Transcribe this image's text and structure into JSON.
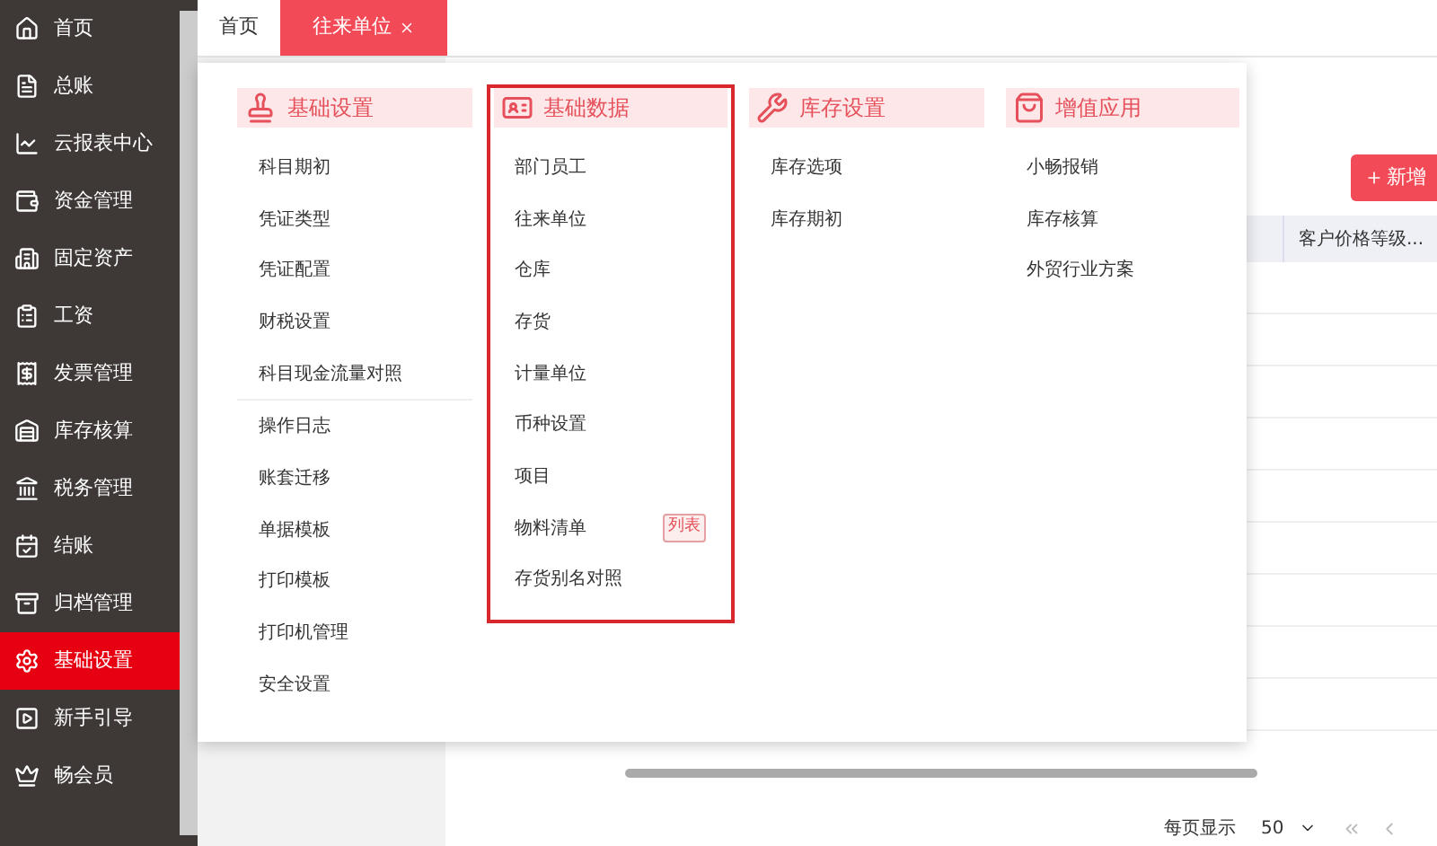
{
  "sidebar": {
    "items": [
      {
        "label": "首页",
        "selected": false
      },
      {
        "label": "总账",
        "selected": false
      },
      {
        "label": "云报表中心",
        "selected": false
      },
      {
        "label": "资金管理",
        "selected": false
      },
      {
        "label": "固定资产",
        "selected": false
      },
      {
        "label": "工资",
        "selected": false
      },
      {
        "label": "发票管理",
        "selected": false
      },
      {
        "label": "库存核算",
        "selected": false
      },
      {
        "label": "税务管理",
        "selected": false
      },
      {
        "label": "结账",
        "selected": false
      },
      {
        "label": "归档管理",
        "selected": false
      },
      {
        "label": "基础设置",
        "selected": true
      },
      {
        "label": "新手引导",
        "selected": false
      },
      {
        "label": "畅会员",
        "selected": false
      }
    ]
  },
  "tabs": [
    {
      "label": "首页",
      "selected": false,
      "closable": false
    },
    {
      "label": "往来单位",
      "selected": true,
      "closable": true
    }
  ],
  "toolbar": {
    "add_button": "新增"
  },
  "table": {
    "columns": [
      "客户价格等级..."
    ]
  },
  "menu": {
    "columns": [
      {
        "title": "基础设置",
        "highlighted": false,
        "items": [
          {
            "kind": "item",
            "label": "科目期初"
          },
          {
            "kind": "item",
            "label": "凭证类型"
          },
          {
            "kind": "item",
            "label": "凭证配置"
          },
          {
            "kind": "item",
            "label": "财税设置"
          },
          {
            "kind": "item",
            "label": "科目现金流量对照"
          },
          {
            "kind": "divider"
          },
          {
            "kind": "item",
            "label": "操作日志"
          },
          {
            "kind": "item",
            "label": "账套迁移"
          },
          {
            "kind": "item",
            "label": "单据模板"
          },
          {
            "kind": "item",
            "label": "打印模板"
          },
          {
            "kind": "item",
            "label": "打印机管理"
          },
          {
            "kind": "item",
            "label": "安全设置"
          }
        ]
      },
      {
        "title": "基础数据",
        "highlighted": true,
        "items": [
          {
            "kind": "item",
            "label": "部门员工"
          },
          {
            "kind": "item",
            "label": "往来单位"
          },
          {
            "kind": "item",
            "label": "仓库"
          },
          {
            "kind": "item",
            "label": "存货"
          },
          {
            "kind": "item",
            "label": "计量单位"
          },
          {
            "kind": "item",
            "label": "币种设置"
          },
          {
            "kind": "item",
            "label": "项目"
          },
          {
            "kind": "item",
            "label": "物料清单",
            "badge": "列表"
          },
          {
            "kind": "item",
            "label": "存货别名对照"
          }
        ]
      },
      {
        "title": "库存设置",
        "highlighted": false,
        "items": [
          {
            "kind": "item",
            "label": "库存选项"
          },
          {
            "kind": "item",
            "label": "库存期初"
          }
        ]
      },
      {
        "title": "增值应用",
        "highlighted": false,
        "items": [
          {
            "kind": "item",
            "label": "小畅报销"
          },
          {
            "kind": "item",
            "label": "库存核算"
          },
          {
            "kind": "item",
            "label": "外贸行业方案"
          }
        ]
      }
    ]
  },
  "pagination": {
    "label": "每页显示",
    "page_size": "50"
  }
}
